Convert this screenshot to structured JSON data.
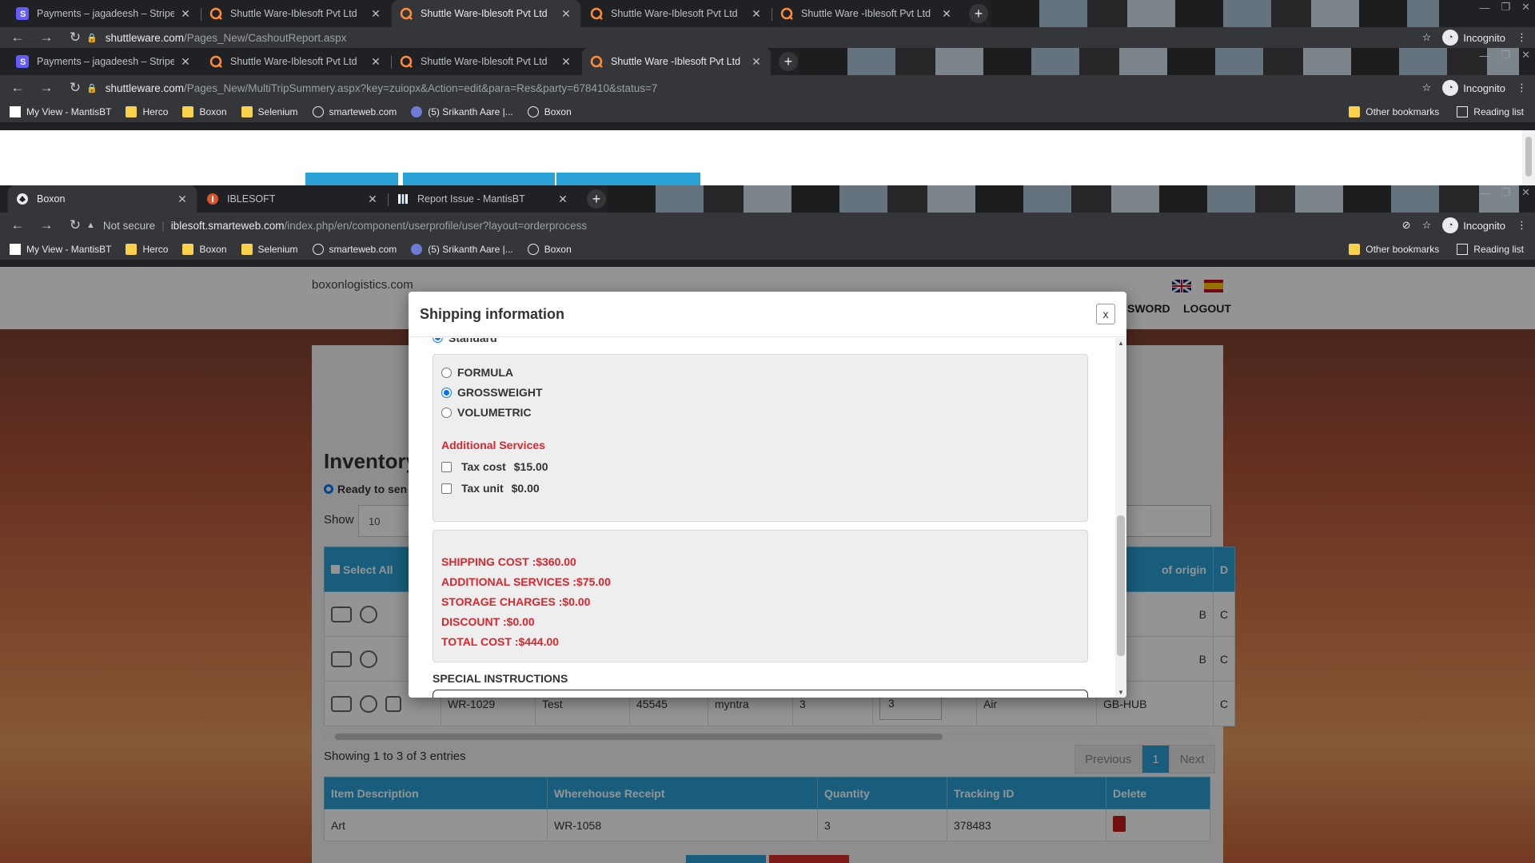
{
  "window1": {
    "tabs": [
      {
        "title": "Payments – jagadeesh – Stripe [T",
        "icon": "stripe-icon",
        "active": false
      },
      {
        "title": "Shuttle Ware-Iblesoft Pvt Ltd",
        "icon": "shuttleware-icon",
        "active": false
      },
      {
        "title": "Shuttle Ware-Iblesoft Pvt Ltd",
        "icon": "shuttleware-icon",
        "active": true
      },
      {
        "title": "Shuttle Ware-Iblesoft Pvt Ltd",
        "icon": "shuttleware-icon",
        "active": false
      },
      {
        "title": "Shuttle Ware -Iblesoft Pvt Ltd",
        "icon": "shuttleware-icon",
        "active": false
      }
    ],
    "url_host": "shuttleware.com",
    "url_path": "/Pages_New/CashoutReport.aspx",
    "profile": "Incognito"
  },
  "window2": {
    "tabs": [
      {
        "title": "Payments – jagadeesh – Stripe [T",
        "icon": "stripe-icon",
        "active": false
      },
      {
        "title": "Shuttle Ware-Iblesoft Pvt Ltd",
        "icon": "shuttleware-icon",
        "active": false
      },
      {
        "title": "Shuttle Ware-Iblesoft Pvt Ltd",
        "icon": "shuttleware-icon",
        "active": false
      },
      {
        "title": "Shuttle Ware -Iblesoft Pvt Ltd",
        "icon": "shuttleware-icon",
        "active": true
      }
    ],
    "url_host": "shuttleware.com",
    "url_path": "/Pages_New/MultiTripSummery.aspx?key=zuiopx&Action=edit&para=Res&party=678410&status=7",
    "profile": "Incognito"
  },
  "window3": {
    "tabs": [
      {
        "title": "Boxon",
        "icon": "boxon-icon",
        "active": true
      },
      {
        "title": "IBLESOFT",
        "icon": "iblesoft-icon",
        "active": false
      },
      {
        "title": "Report Issue - MantisBT",
        "icon": "mantis-icon",
        "active": false
      }
    ],
    "not_secure": "Not secure",
    "url_host": "iblesoft.smarteweb.com",
    "url_path": "/index.php/en/component/userprofile/user?layout=orderprocess",
    "profile": "Incognito"
  },
  "bookmarks": {
    "items": [
      "My View - MantisBT",
      "Herco",
      "Boxon",
      "Selenium",
      "smarteweb.com",
      "(5) Srikanth Aare |...",
      "Boxon"
    ],
    "other": "Other bookmarks",
    "reading": "Reading list"
  },
  "site": {
    "logo_alt": "boxonlogistics.com",
    "nav_password": "SWORD",
    "nav_logout": "LOGOUT",
    "inventory_title": "Inventory",
    "ready_label": "Ready to sen",
    "show_label": "Show",
    "show_value": "10",
    "inventory_headers": [
      "Select All",
      "of origin",
      "D"
    ],
    "inventory_rows": [
      {
        "wr": "",
        "item": "",
        "val": "",
        "store": "",
        "qty": "",
        "qtybox": "",
        "mode": "",
        "origin": "B",
        "d": "C"
      },
      {
        "wr": "",
        "item": "",
        "val": "",
        "store": "",
        "qty": "",
        "qtybox": "",
        "mode": "",
        "origin": "B",
        "d": "C"
      },
      {
        "wr": "WR-1029",
        "item": "Test",
        "val": "45545",
        "store": "myntra",
        "qty": "3",
        "qtybox": "3",
        "mode": "Air",
        "origin": "GB-HUB",
        "d": "C"
      }
    ],
    "showing": "Showing 1 to 3 of 3 entries",
    "pager": {
      "prev": "Previous",
      "page": "1",
      "next": "Next"
    },
    "selected_headers": [
      "Item Description",
      "Wherehouse Receipt",
      "Quantity",
      "Tracking ID",
      "Delete"
    ],
    "selected_rows": [
      {
        "desc": "Art",
        "receipt": "WR-1058",
        "qty": "3",
        "tracking": "378483"
      }
    ]
  },
  "modal": {
    "title": "Shipping information",
    "close": "x",
    "partial_option": "Standard",
    "calc_options": [
      {
        "label": "FORMULA",
        "selected": false
      },
      {
        "label": "GROSSWEIGHT",
        "selected": true
      },
      {
        "label": "VOLUMETRIC",
        "selected": false
      }
    ],
    "additional_services_title": "Additional Services",
    "services": [
      {
        "label": "Tax cost",
        "price": "$15.00",
        "checked": false
      },
      {
        "label": "Tax unit",
        "price": "$0.00",
        "checked": false
      }
    ],
    "costs": {
      "shipping": "SHIPPING COST :$360.00",
      "additional": "ADDITIONAL SERVICES :$75.00",
      "storage": "STORAGE CHARGES :$0.00",
      "discount": "DISCOUNT :$0.00",
      "total": "TOTAL COST :$444.00"
    },
    "special_instructions": "SPECIAL INSTRUCTIONS"
  },
  "colors": {
    "accent_blue": "#2aa2d6",
    "cost_red": "#d9262e",
    "chrome_dark": "#202124",
    "chrome_toolbar": "#35363a"
  }
}
